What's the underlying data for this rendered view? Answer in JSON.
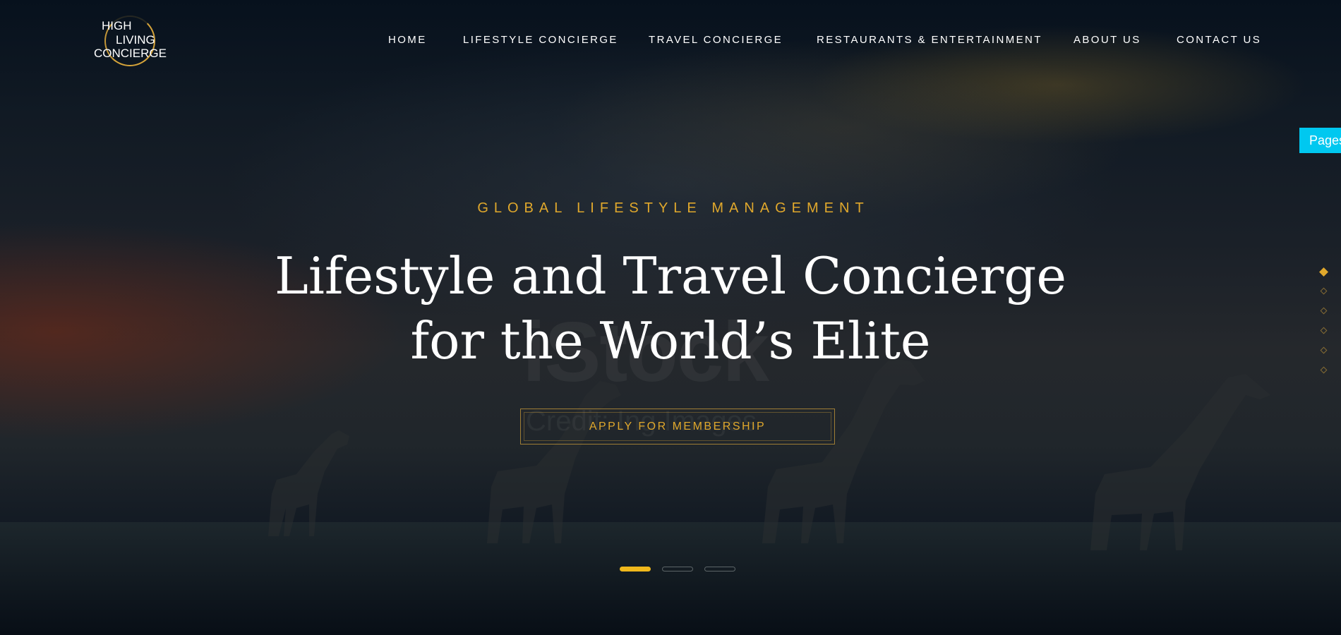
{
  "logo": {
    "line1": "HIGH",
    "line2": "LIVING",
    "line3": "CONCIERGE"
  },
  "nav": {
    "items": [
      {
        "label": "HOME"
      },
      {
        "label": "LIFESTYLE CONCIERGE"
      },
      {
        "label": "TRAVEL CONCIERGE"
      },
      {
        "label": "RESTAURANTS & ENTERTAINMENT"
      },
      {
        "label": "ABOUT US"
      },
      {
        "label": "CONTACT US"
      }
    ]
  },
  "hero": {
    "eyebrow": "GLOBAL LIFESTYLE MANAGEMENT",
    "headline_line1": "Lifestyle and Travel Concierge",
    "headline_line2": "for the World’s Elite",
    "cta_label": "APPLY FOR MEMBERSHIP",
    "watermark": "iStock",
    "watermark_sub": "Credit: Ing Images"
  },
  "side": {
    "pages_label": "Pages",
    "dots_count": 6,
    "active_dot": 1
  },
  "slider": {
    "slides_count": 3,
    "active_slide": 1
  },
  "colors": {
    "accent_gold": "#e0a82c",
    "slider_active": "#f0b81c",
    "pages_tab": "#00c8f0",
    "text": "#ffffff"
  }
}
